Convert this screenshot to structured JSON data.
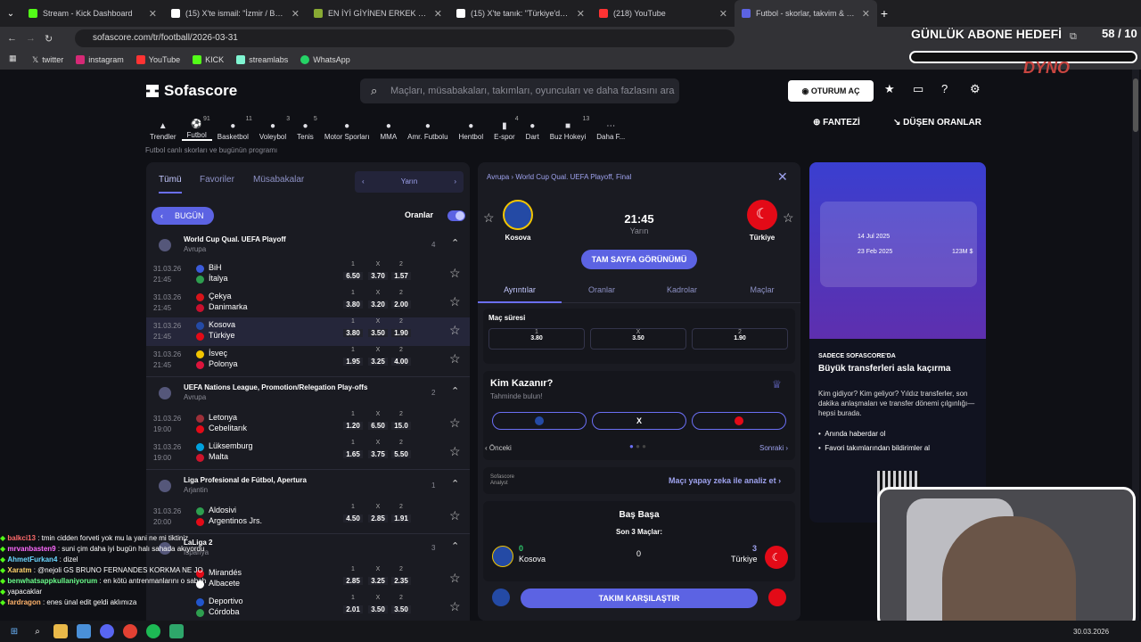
{
  "browser": {
    "tabs": [
      {
        "title": "Stream - Kick Dashboard",
        "color": "#53fc18"
      },
      {
        "title": "(15) X'te ismail: \"İzmir / Bakırçay",
        "color": "#ffffff"
      },
      {
        "title": "EN İYİ GİYİNEN ERKEK - Tier Li",
        "color": "#88aa33"
      },
      {
        "title": "(15) X'te tanık: \"Türkiye'de il ola",
        "color": "#ffffff"
      },
      {
        "title": "(218) YouTube",
        "color": "#ff3333"
      },
      {
        "title": "Futbol - skorlar, takvim & oranl",
        "color": "#5c63e3"
      }
    ],
    "url": "sofascore.com/tr/football/2026-03-31",
    "bookmarks": [
      "twitter",
      "instagram",
      "YouTube",
      "KICK",
      "streamlabs",
      "WhatsApp"
    ]
  },
  "overlay": {
    "title": "GÜNLÜK ABONE HEDEFİ",
    "count": "58 / 10",
    "brand": "DYNO"
  },
  "site": {
    "logo": "Sofascore",
    "search_placeholder": "Maçları, müsabakaları, takımları, oyuncuları ve daha fazlasını ara",
    "login": "OTURUM AÇ",
    "fantezi": "FANTEZİ",
    "dusen": "DÜŞEN ORANLAR",
    "subtitle": "Futbol canlı skorları ve bugünün programı",
    "sports": [
      {
        "label": "Trendler",
        "count": ""
      },
      {
        "label": "Futbol",
        "count": "91"
      },
      {
        "label": "Basketbol",
        "count": "11"
      },
      {
        "label": "Voleybol",
        "count": "3"
      },
      {
        "label": "Tenis",
        "count": "5"
      },
      {
        "label": "Motor Sporları",
        "count": ""
      },
      {
        "label": "MMA",
        "count": ""
      },
      {
        "label": "Amr. Futbolu",
        "count": ""
      },
      {
        "label": "Hentbol",
        "count": ""
      },
      {
        "label": "E-spor",
        "count": "4"
      },
      {
        "label": "Dart",
        "count": ""
      },
      {
        "label": "Buz Hokeyi",
        "count": "13"
      },
      {
        "label": "Daha F...",
        "count": ""
      }
    ]
  },
  "left": {
    "tabs": [
      "Tümü",
      "Favoriler",
      "Müsabakalar"
    ],
    "day": "Yarın",
    "today_btn": "BUGÜN",
    "odds_label": "Oranlar",
    "leagues": [
      {
        "name": "World Cup Qual. UEFA Playoff",
        "country": "Avrupa",
        "count": "4"
      },
      {
        "name": "UEFA Nations League, Promotion/Relegation Play-offs",
        "country": "Avrupa",
        "count": "2"
      },
      {
        "name": "Liga Profesional de Fútbol, Apertura",
        "country": "Arjantin",
        "count": "1"
      },
      {
        "name": "LaLiga 2",
        "country": "İspanya",
        "count": "3"
      }
    ],
    "matches": [
      {
        "date": "31.03.26",
        "time": "21:45",
        "home": "BiH",
        "away": "İtalya",
        "o1": "6.50",
        "ox": "3.70",
        "o2": "1.57",
        "ch": "#3b5bdb",
        "ca": "#2e9e4f"
      },
      {
        "date": "31.03.26",
        "time": "21:45",
        "home": "Çekya",
        "away": "Danimarka",
        "o1": "3.80",
        "ox": "3.20",
        "o2": "2.00",
        "ch": "#d7141a",
        "ca": "#c8102e"
      },
      {
        "date": "31.03.26",
        "time": "21:45",
        "home": "Kosova",
        "away": "Türkiye",
        "o1": "3.80",
        "ox": "3.50",
        "o2": "1.90",
        "ch": "#244aa5",
        "ca": "#e30a17"
      },
      {
        "date": "31.03.26",
        "time": "21:45",
        "home": "İsveç",
        "away": "Polonya",
        "o1": "1.95",
        "ox": "3.25",
        "o2": "4.00",
        "ch": "#f2c500",
        "ca": "#dc143c"
      },
      {
        "date": "31.03.26",
        "time": "19:00",
        "home": "Letonya",
        "away": "Cebelitarık",
        "o1": "1.20",
        "ox": "6.50",
        "o2": "15.0",
        "ch": "#9e3039",
        "ca": "#e30a17"
      },
      {
        "date": "31.03.26",
        "time": "19:00",
        "home": "Lüksemburg",
        "away": "Malta",
        "o1": "1.65",
        "ox": "3.75",
        "o2": "5.50",
        "ch": "#00a1de",
        "ca": "#cf142b"
      },
      {
        "date": "31.03.26",
        "time": "20:00",
        "home": "Aldosivi",
        "away": "Argentinos Jrs.",
        "o1": "4.50",
        "ox": "2.85",
        "o2": "1.91",
        "ch": "#2e9e4f",
        "ca": "#e30a17"
      },
      {
        "date": "",
        "time": "",
        "home": "Mirandés",
        "away": "Albacete",
        "o1": "2.85",
        "ox": "3.25",
        "o2": "2.35",
        "ch": "#e30a17",
        "ca": "#ffffff"
      },
      {
        "date": "",
        "time": "",
        "home": "Deportivo",
        "away": "Córdoba",
        "o1": "2.01",
        "ox": "3.50",
        "o2": "3.50",
        "ch": "#2255cc",
        "ca": "#2e9e4f"
      }
    ]
  },
  "detail": {
    "breadcrumb": "Avrupa  ›  World Cup Qual. UEFA Playoff, Final",
    "home": "Kosova",
    "away": "Türkiye",
    "time": "21:45",
    "day": "Yarın",
    "full_btn": "TAM SAYFA GÖRÜNÜMÜ",
    "tabs": [
      "Ayrıntılar",
      "Oranlar",
      "Kadrolar",
      "Maçlar"
    ],
    "odds_title": "Maç süresi",
    "odds": [
      {
        "l": "1",
        "v": "3.80"
      },
      {
        "l": "X",
        "v": "3.50"
      },
      {
        "l": "2",
        "v": "1.90"
      }
    ],
    "who": "Kim Kazanır?",
    "who_sub": "Tahminde bulun!",
    "draw": "X",
    "prev": "Önceki",
    "next": "Sonraki",
    "ai": "Maçı yapay zeka ile analiz et",
    "analyst": "Sofascore Analyst",
    "h2h": "Baş Başa",
    "h2h_sub": "Son 3 Maçlar:",
    "hw": "0",
    "dr": "0",
    "aw": "3",
    "compare": "TAKIM KARŞILAŞTIR"
  },
  "ad": {
    "eyebrow": "SADECE SOFASCORE'DA",
    "title": "Büyük transferleri asla kaçırma",
    "body": "Kim gidiyor? Kim geliyor? Yıldız transferler, son dakika anlaşmaları ve transfer dönemi çılgınlığı—hepsi burada.",
    "bullets": [
      "Anında haberdar ol",
      "Favori takımlarından bildirimler al"
    ],
    "dates": [
      "14 Jul 2025",
      "23 Feb 2025"
    ],
    "fee": "123M $"
  },
  "chat": [
    {
      "user": "balkci13",
      "msg": ": tmin cidden forveti yok mu la yani ne mi tiktiniz",
      "color": "#ff6b6b"
    },
    {
      "user": "mrvanbasten9",
      "msg": ": suni çim daha iyi bugün halı sahada akıyordu",
      "color": "#ff6bff"
    },
    {
      "user": "AhmetFurkan4",
      "msg": ": dizel",
      "color": "#6bd7ff"
    },
    {
      "user": "Xaratm",
      "msg": ": @nejoli GS BRUNO FERNANDES KORKMA NE JO",
      "color": "#ffd36b"
    },
    {
      "user": "benwhatsappkullaniyorum",
      "msg": ": en kötü antrenmanlarını o sabah",
      "color": "#6bff8b"
    },
    {
      "user": "",
      "msg": "yapacaklar",
      "color": "#ffffff"
    },
    {
      "user": "fardragon",
      "msg": ": enes ünal edit geldi aklımıza",
      "color": "#ffb36b"
    }
  ],
  "taskbar": {
    "clock": "30.03.2026"
  }
}
